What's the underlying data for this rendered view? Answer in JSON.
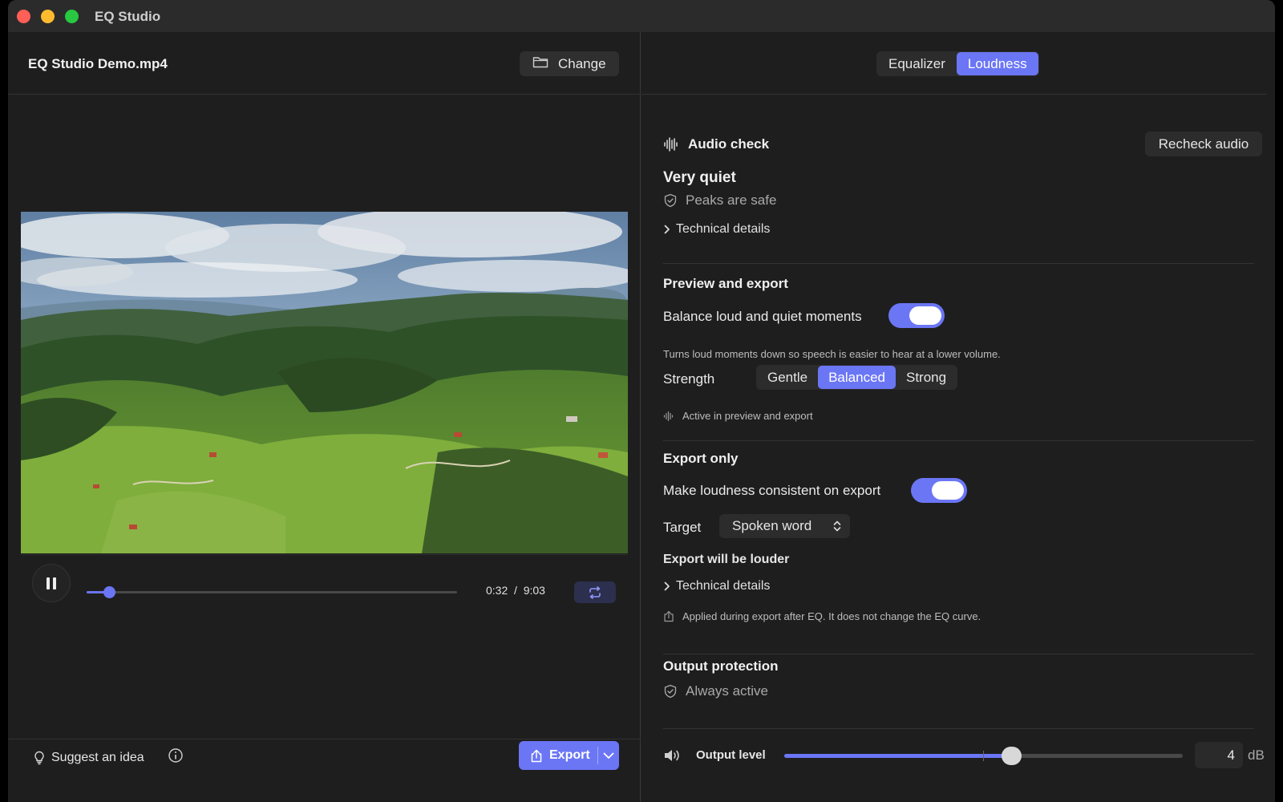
{
  "app": {
    "title": "EQ Studio"
  },
  "left": {
    "file_name": "EQ Studio Demo.mp4",
    "change_label": "Change",
    "player": {
      "current_time": "0:32",
      "separator": "/",
      "duration": "9:03",
      "progress_fraction": 0.06
    },
    "suggest_label": "Suggest an idea",
    "export_label": "Export"
  },
  "right": {
    "tabs": [
      {
        "label": "Equalizer",
        "active": false
      },
      {
        "label": "Loudness",
        "active": true
      }
    ],
    "audio_check": {
      "title": "Audio check",
      "recheck_label": "Recheck audio",
      "status": "Very quiet",
      "peaks": "Peaks are safe",
      "tech_details": "Technical details"
    },
    "preview": {
      "title": "Preview and export",
      "balance_label": "Balance loud and quiet moments",
      "balance_on": true,
      "balance_desc": "Turns loud moments down so speech is easier to hear at a lower volume.",
      "strength_label": "Strength",
      "strength_options": [
        "Gentle",
        "Balanced",
        "Strong"
      ],
      "strength_selected": "Balanced",
      "active_note": "Active in preview and export"
    },
    "export_only": {
      "title": "Export only",
      "consistent_label": "Make loudness consistent on export",
      "consistent_on": true,
      "target_label": "Target",
      "target_value": "Spoken word",
      "louder_label": "Export will be louder",
      "tech_details": "Technical details",
      "applied_note": "Applied during export after EQ. It does not change the EQ curve."
    },
    "output_protection": {
      "title": "Output protection",
      "status": "Always active"
    },
    "output_level": {
      "label": "Output level",
      "value": "4",
      "unit": "dB",
      "slider_fraction": 0.57
    }
  },
  "colors": {
    "accent": "#6b76f5",
    "background": "#1e1e1e",
    "titlebar": "#2b2b2b"
  }
}
